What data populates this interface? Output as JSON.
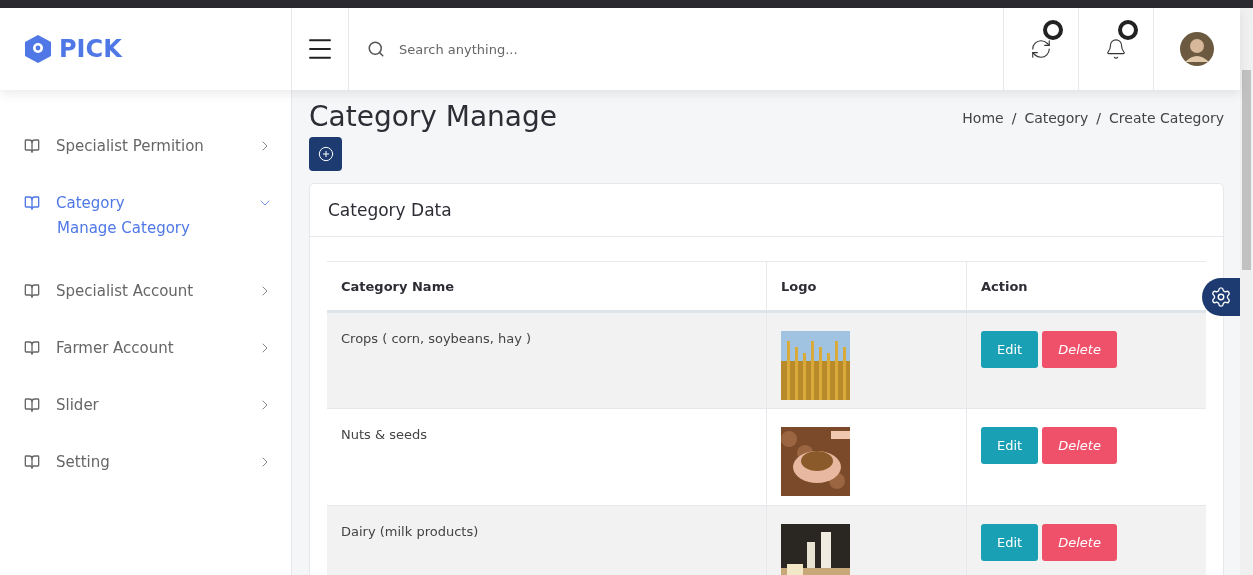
{
  "brand": {
    "name": "PICK"
  },
  "search": {
    "placeholder": "Search anything..."
  },
  "sidebar": {
    "items": [
      {
        "label": "Specialist Permition",
        "selected": false,
        "expanded": false
      },
      {
        "label": "Category",
        "selected": true,
        "expanded": true,
        "children": [
          {
            "label": "Manage Category",
            "selected": true
          }
        ]
      },
      {
        "label": "Specialist Account",
        "selected": false,
        "expanded": false
      },
      {
        "label": "Farmer Account",
        "selected": false,
        "expanded": false
      },
      {
        "label": "Slider",
        "selected": false,
        "expanded": false
      },
      {
        "label": "Setting",
        "selected": false,
        "expanded": false
      }
    ]
  },
  "page": {
    "title": "Category Manage",
    "breadcrumb": [
      "Home",
      "Category",
      "Create Category"
    ],
    "separator": "/"
  },
  "card": {
    "title": "Category Data"
  },
  "table": {
    "columns": [
      "Category Name",
      "Logo",
      "Action"
    ],
    "rows": [
      {
        "name": "Crops ( corn, soybeans, hay )",
        "logo": {
          "kind": "picture"
        },
        "actions": [
          "Edit",
          "Delete"
        ]
      },
      {
        "name": "Nuts & seeds",
        "logo": {
          "kind": "picture"
        },
        "actions": [
          "Edit",
          "Delete"
        ]
      },
      {
        "name": "Dairy (milk products)",
        "logo": {
          "kind": "picture"
        },
        "actions": [
          "Edit",
          "Delete"
        ]
      }
    ]
  }
}
